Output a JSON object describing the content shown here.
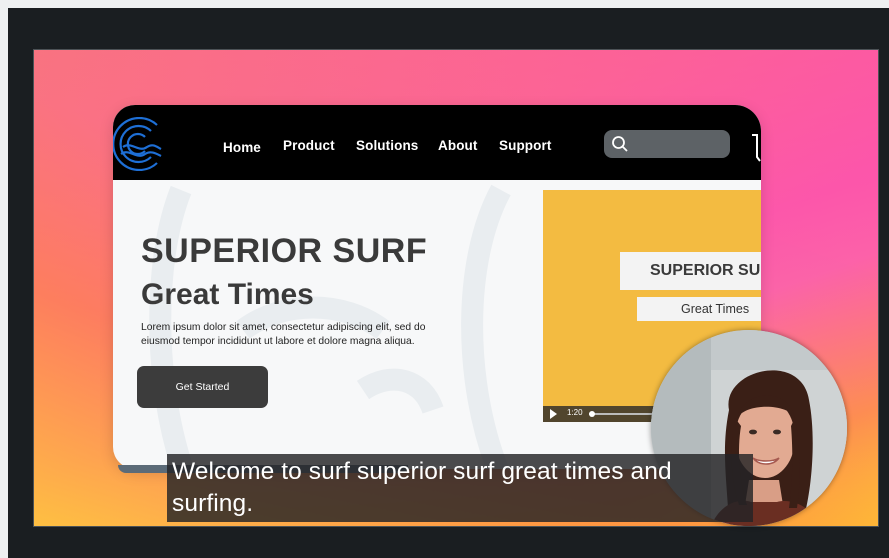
{
  "site": {
    "nav": {
      "items": [
        "Home",
        "Product",
        "Solutions",
        "About",
        "Support"
      ]
    },
    "hero": {
      "title": "SUPERIOR SURF",
      "subtitle": "Great Times",
      "body_line1": "Lorem ipsum dolor sit amet, consectetur adipiscing elit, sed do",
      "body_line2": "eiusmod tempor incididunt ut labore et dolore magna aliqua.",
      "cta_label": "Get Started"
    },
    "video": {
      "title": "SUPERIOR SU",
      "subtitle": "Great Times",
      "time": "1:20",
      "progress": 0.02
    }
  },
  "caption": {
    "text": "Welcome to surf superior surf great times and surfing."
  },
  "colors": {
    "accent_yellow": "#f3bb41",
    "nav_bg": "#000000",
    "logo_blue": "#1e6fd6",
    "button_dark": "#3c3c3c"
  }
}
